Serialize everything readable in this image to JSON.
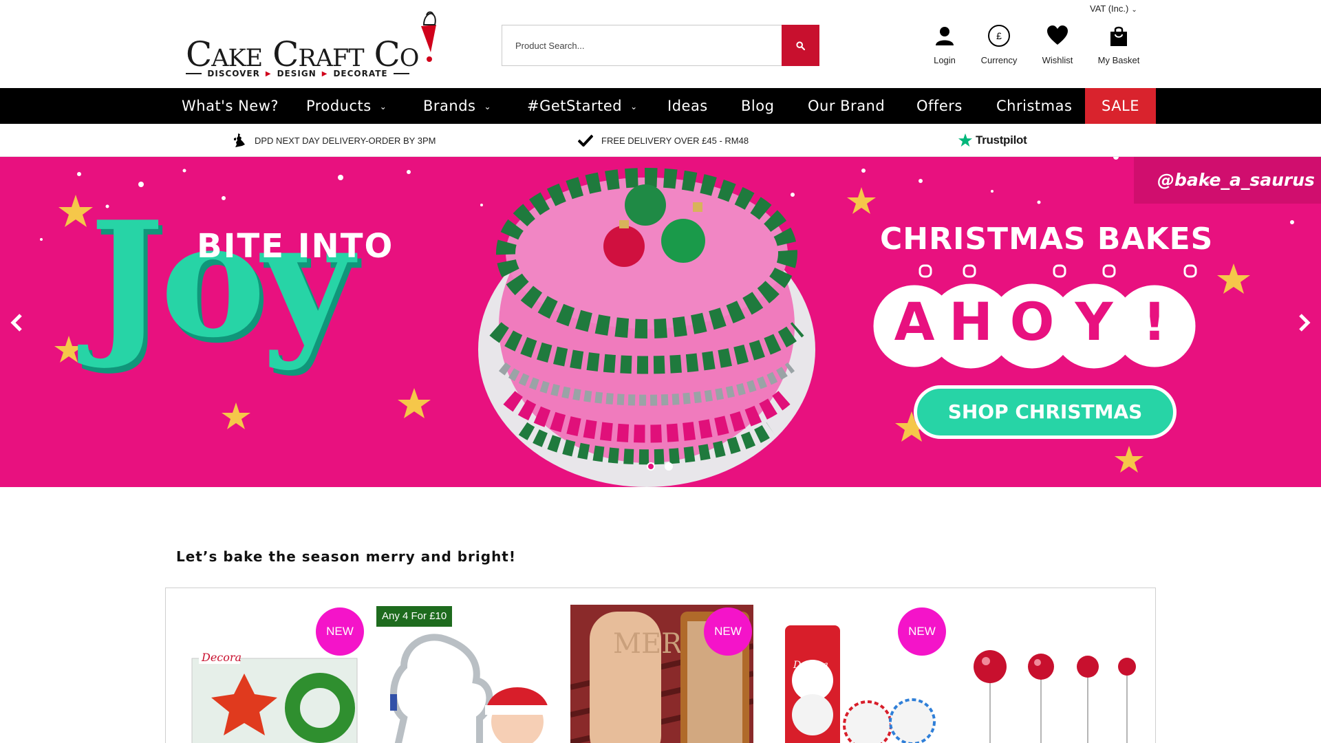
{
  "brand": {
    "name": "Cake Craft Co",
    "tagline": [
      "DISCOVER",
      "DESIGN",
      "DECORATE"
    ]
  },
  "search": {
    "placeholder": "Product Search..."
  },
  "header": {
    "vat_label": "VAT (Inc.)",
    "actions": [
      {
        "label": "Login",
        "icon": "user-icon"
      },
      {
        "label": "Currency",
        "icon": "pound-currency-icon"
      },
      {
        "label": "Wishlist",
        "icon": "heart-icon"
      },
      {
        "label": "My Basket",
        "icon": "shopping-bag-icon"
      }
    ]
  },
  "nav": {
    "items": [
      {
        "label": "What's New?",
        "dropdown": false
      },
      {
        "label": "Products",
        "dropdown": true
      },
      {
        "label": "Brands",
        "dropdown": true
      },
      {
        "label": "#GetStarted",
        "dropdown": true
      },
      {
        "label": "Ideas",
        "dropdown": false
      },
      {
        "label": "Blog",
        "dropdown": false
      },
      {
        "label": "Our Brand",
        "dropdown": false
      },
      {
        "label": "Offers",
        "dropdown": false
      },
      {
        "label": "Christmas",
        "dropdown": false
      },
      {
        "label": "SALE",
        "dropdown": false
      }
    ]
  },
  "usp": {
    "delivery": "DPD NEXT DAY DELIVERY-ORDER BY 3PM",
    "free_delivery": "FREE DELIVERY OVER £45 - RM48",
    "trustpilot": "Trustpilot"
  },
  "hero": {
    "headline_small": "BITE INTO",
    "headline_big": "Joy",
    "right_title": "CHRISTMAS BAKES",
    "right_big": "AHOY!",
    "cta": "SHOP CHRISTMAS",
    "credit": "@bake_a_saurus",
    "active_slide": 1,
    "slide_count": 2,
    "colors": {
      "background": "#e8117f",
      "accent": "#27d4a6"
    }
  },
  "section": {
    "intro": "Let’s bake the season merry and bright!"
  },
  "products": [
    {
      "badge": "NEW",
      "brand_label": "Decora"
    },
    {
      "badge": "Any 4 For £10"
    },
    {
      "badge": "NEW",
      "text": "MERRY"
    },
    {
      "badge": "NEW",
      "brand_label": "Decora"
    },
    {
      "badge": ""
    }
  ],
  "colors": {
    "brand_red": "#c8102e",
    "nav_bg": "#000000",
    "sale_bg": "#d9232d",
    "new_badge": "#f414c9",
    "deal_badge": "#1e6b1e"
  }
}
